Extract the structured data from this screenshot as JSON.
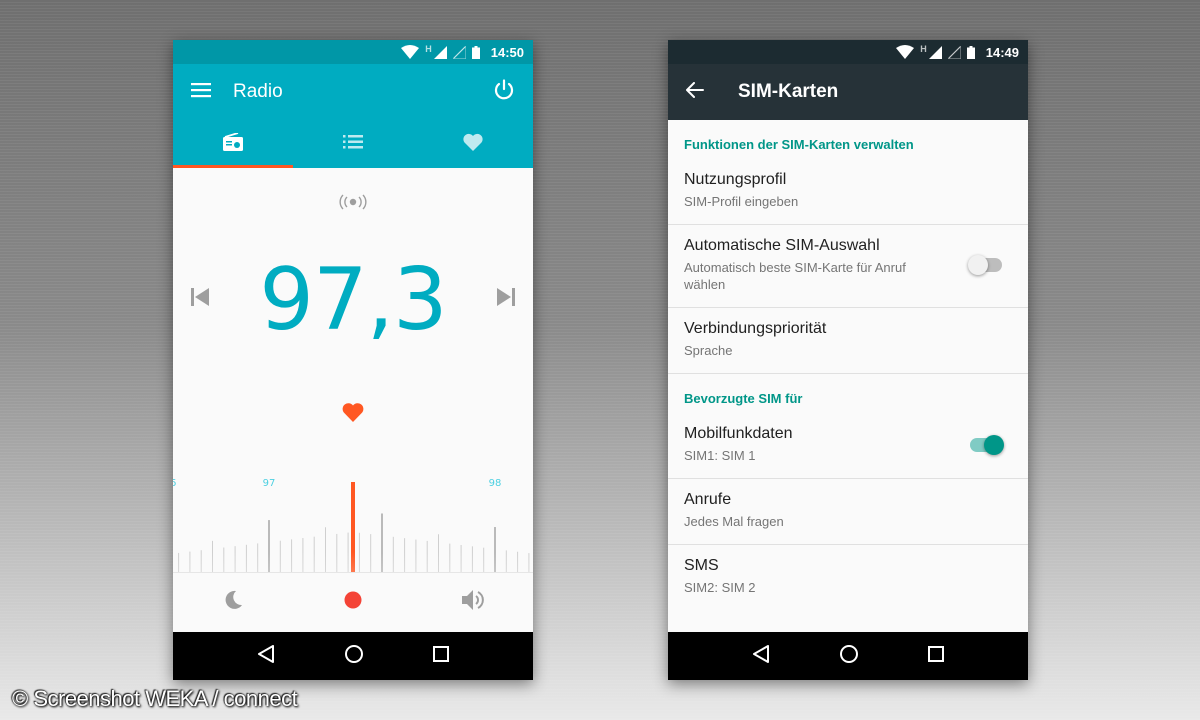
{
  "radio_app": {
    "status_time": "14:50",
    "status_network": "H",
    "title": "Radio",
    "tabs": [
      {
        "icon": "radio-icon",
        "active": true
      },
      {
        "icon": "list-icon",
        "active": false
      },
      {
        "icon": "heart-icon",
        "active": false
      }
    ],
    "frequency": "97,3",
    "dial_labels": [
      "97",
      "98"
    ],
    "bottom_controls": [
      "moon-icon",
      "record-icon",
      "volume-icon"
    ],
    "colors": {
      "primary": "#00acc1",
      "accent": "#ff5722",
      "record": "#f44336"
    }
  },
  "sim_app": {
    "status_time": "14:49",
    "status_network": "H",
    "title": "SIM-Karten",
    "sections": [
      {
        "header": "Funktionen der SIM-Karten verwalten",
        "items": [
          {
            "title": "Nutzungsprofil",
            "summary": "SIM-Profil eingeben"
          },
          {
            "title": "Automatische SIM-Auswahl",
            "summary": "Automatisch beste SIM-Karte für Anruf wählen",
            "switch": "off"
          },
          {
            "title": "Verbindungspriorität",
            "summary": "Sprache"
          }
        ]
      },
      {
        "header": "Bevorzugte SIM für",
        "items": [
          {
            "title": "Mobilfunkdaten",
            "summary": "SIM1: SIM 1",
            "switch": "on"
          },
          {
            "title": "Anrufe",
            "summary": "Jedes Mal fragen"
          },
          {
            "title": "SMS",
            "summary": "SIM2: SIM 2"
          }
        ]
      }
    ],
    "colors": {
      "appbar": "#263238",
      "accent": "#009688"
    }
  },
  "watermark": "© Screenshot WEKA / connect"
}
